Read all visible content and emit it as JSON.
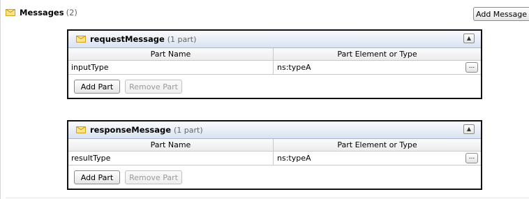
{
  "messages": {
    "title": "Messages",
    "count": "(2)",
    "add_button": "Add Message",
    "icon": "envelope-icon"
  },
  "panels": [
    {
      "name": "requestMessage",
      "parts": "(1 part)",
      "columns": [
        "Part Name",
        "Part Element or Type"
      ],
      "rows": [
        {
          "part_name": "inputType",
          "element": "ns:typeA",
          "browse": "..."
        }
      ],
      "add_part": "Add Part",
      "remove_part": "Remove Part",
      "collapse": "▲"
    },
    {
      "name": "responseMessage",
      "parts": "(1 part)",
      "columns": [
        "Part Name",
        "Part Element or Type"
      ],
      "rows": [
        {
          "part_name": "resultType",
          "element": "ns:typeA",
          "browse": "..."
        }
      ],
      "add_part": "Add Part",
      "remove_part": "Remove Part",
      "collapse": "▲"
    }
  ],
  "colors": {
    "envelope": "#fde48a",
    "panel_header": "#d9e3f1",
    "panel_border": "#111111"
  }
}
